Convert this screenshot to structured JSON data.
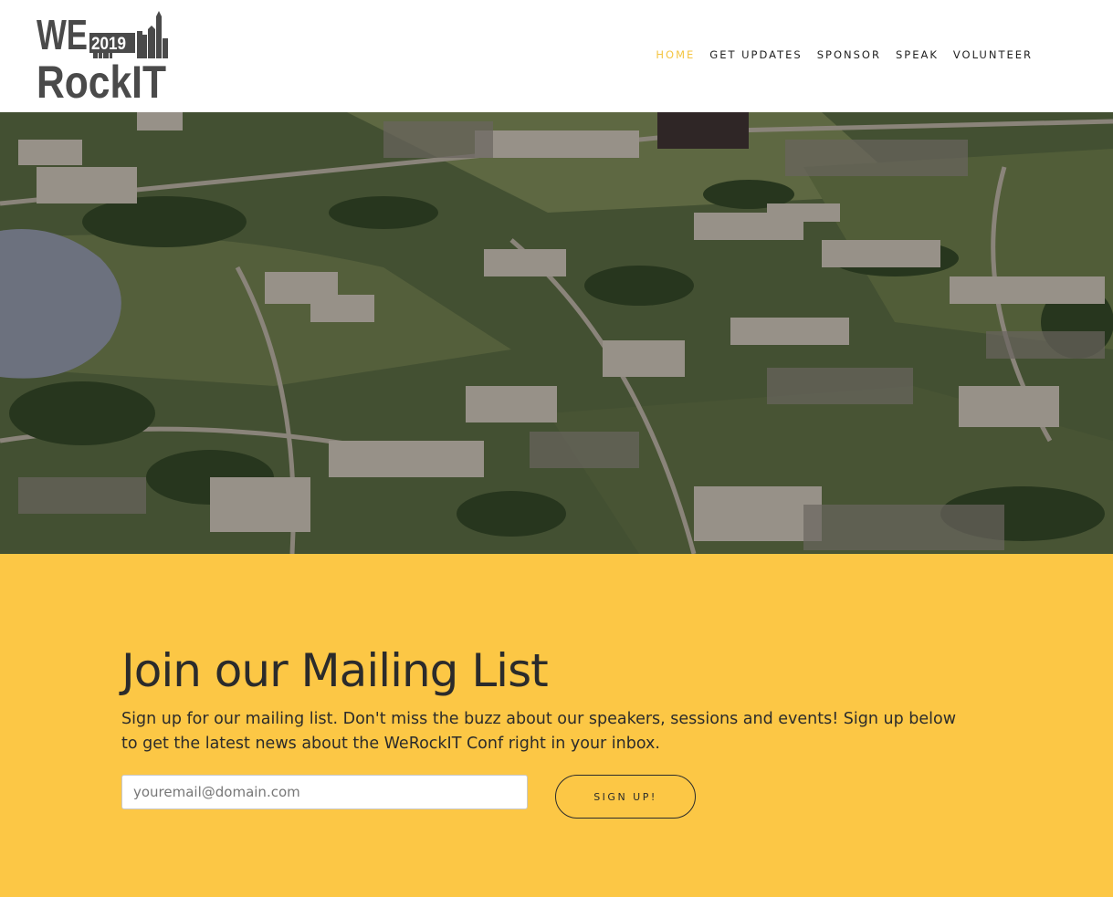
{
  "logo": {
    "line1": "WE",
    "year": "2019",
    "line2": "RockIT"
  },
  "nav": {
    "items": [
      {
        "label": "Home",
        "active": true
      },
      {
        "label": "Get Updates",
        "active": false
      },
      {
        "label": "Sponsor",
        "active": false
      },
      {
        "label": "Speak",
        "active": false
      },
      {
        "label": "Volunteer",
        "active": false
      }
    ]
  },
  "colors": {
    "accent": "#f4c542",
    "mailing_bg": "#fcc745",
    "text_dark": "#2b2b2b"
  },
  "mailing": {
    "title": "Join our Mailing List",
    "description": "Sign up for our mailing list. Don't miss the buzz about our speakers, sessions and events! Sign up below to get the latest news about the WeRockIT Conf right in your inbox.",
    "email_placeholder": "youremail@domain.com",
    "email_value": "",
    "signup_label": "Sign up!"
  }
}
